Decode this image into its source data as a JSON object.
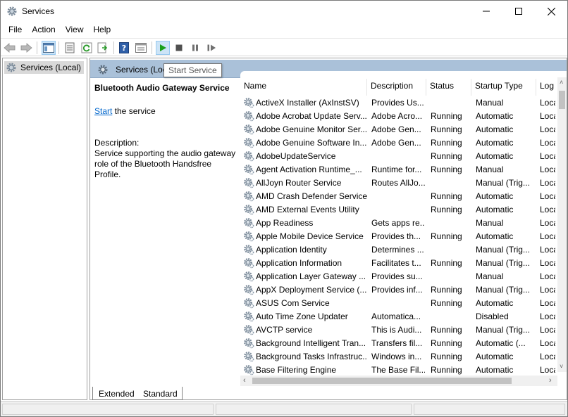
{
  "window": {
    "title": "Services"
  },
  "menu": {
    "items": [
      "File",
      "Action",
      "View",
      "Help"
    ]
  },
  "toolbar": {
    "buttons": [
      "back-icon",
      "forward-icon",
      "show-hide-tree-icon",
      "properties-icon",
      "refresh-icon",
      "export-icon",
      "help-icon",
      "mmc-view-icon",
      "play-icon",
      "stop-icon",
      "pause-icon",
      "resume-icon"
    ]
  },
  "tree": {
    "root_label": "Services (Local)"
  },
  "pane": {
    "header_title": "Services (Local)",
    "tooltip": "Start Service"
  },
  "details": {
    "service_name": "Bluetooth Audio Gateway Service",
    "action_link": "Start",
    "action_suffix": " the service",
    "description_label": "Description:",
    "description_text": "Service supporting the audio gateway role of the Bluetooth Handsfree Profile."
  },
  "list": {
    "columns": [
      "Name",
      "Description",
      "Status",
      "Startup Type",
      "Log"
    ],
    "rows": [
      {
        "name": "ActiveX Installer (AxInstSV)",
        "description": "Provides Us...",
        "status": "",
        "startup": "Manual",
        "log": "Loca"
      },
      {
        "name": "Adobe Acrobat Update Serv...",
        "description": "Adobe Acro...",
        "status": "Running",
        "startup": "Automatic",
        "log": "Loca"
      },
      {
        "name": "Adobe Genuine Monitor Ser...",
        "description": "Adobe Gen...",
        "status": "Running",
        "startup": "Automatic",
        "log": "Loca"
      },
      {
        "name": "Adobe Genuine Software In...",
        "description": "Adobe Gen...",
        "status": "Running",
        "startup": "Automatic",
        "log": "Loca"
      },
      {
        "name": "AdobeUpdateService",
        "description": "",
        "status": "Running",
        "startup": "Automatic",
        "log": "Loca"
      },
      {
        "name": "Agent Activation Runtime_...",
        "description": "Runtime for...",
        "status": "Running",
        "startup": "Manual",
        "log": "Loca"
      },
      {
        "name": "AllJoyn Router Service",
        "description": "Routes AllJo...",
        "status": "",
        "startup": "Manual (Trig...",
        "log": "Loca"
      },
      {
        "name": "AMD Crash Defender Service",
        "description": "",
        "status": "Running",
        "startup": "Automatic",
        "log": "Loca"
      },
      {
        "name": "AMD External Events Utility",
        "description": "",
        "status": "Running",
        "startup": "Automatic",
        "log": "Loca"
      },
      {
        "name": "App Readiness",
        "description": "Gets apps re...",
        "status": "",
        "startup": "Manual",
        "log": "Loca"
      },
      {
        "name": "Apple Mobile Device Service",
        "description": "Provides th...",
        "status": "Running",
        "startup": "Automatic",
        "log": "Loca"
      },
      {
        "name": "Application Identity",
        "description": "Determines ...",
        "status": "",
        "startup": "Manual (Trig...",
        "log": "Loca"
      },
      {
        "name": "Application Information",
        "description": "Facilitates t...",
        "status": "Running",
        "startup": "Manual (Trig...",
        "log": "Loca"
      },
      {
        "name": "Application Layer Gateway ...",
        "description": "Provides su...",
        "status": "",
        "startup": "Manual",
        "log": "Loca"
      },
      {
        "name": "AppX Deployment Service (...",
        "description": "Provides inf...",
        "status": "Running",
        "startup": "Manual (Trig...",
        "log": "Loca"
      },
      {
        "name": "ASUS Com Service",
        "description": "",
        "status": "Running",
        "startup": "Automatic",
        "log": "Loca"
      },
      {
        "name": "Auto Time Zone Updater",
        "description": "Automatica...",
        "status": "",
        "startup": "Disabled",
        "log": "Loca"
      },
      {
        "name": "AVCTP service",
        "description": "This is Audi...",
        "status": "Running",
        "startup": "Manual (Trig...",
        "log": "Loca"
      },
      {
        "name": "Background Intelligent Tran...",
        "description": "Transfers fil...",
        "status": "Running",
        "startup": "Automatic (...",
        "log": "Loca"
      },
      {
        "name": "Background Tasks Infrastruc...",
        "description": "Windows in...",
        "status": "Running",
        "startup": "Automatic",
        "log": "Loca"
      },
      {
        "name": "Base Filtering Engine",
        "description": "The Base Fil...",
        "status": "Running",
        "startup": "Automatic",
        "log": "Loca"
      }
    ]
  },
  "tabs": {
    "extended": "Extended",
    "standard": "Standard"
  },
  "colors": {
    "pane_header": "#aac1d9",
    "link": "#0066cc",
    "play_green": "#1aa01a"
  }
}
